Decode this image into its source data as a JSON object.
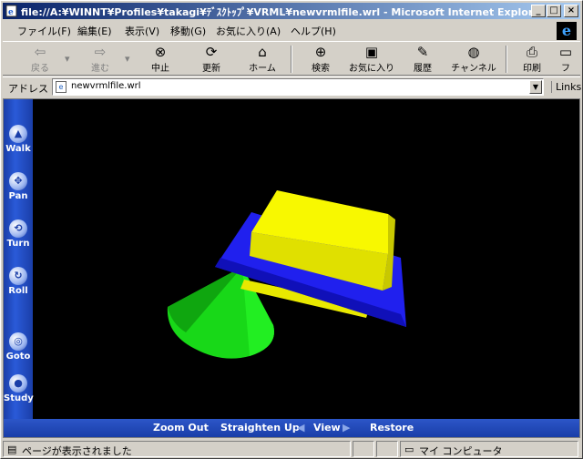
{
  "window": {
    "title": "file://A:¥WINNT¥Profiles¥takagi¥ﾃﾞｽｸﾄｯﾌﾟ¥VRML¥newvrmlfile.wrl - Microsoft Internet Explorer",
    "controls": {
      "minimize": "_",
      "maximize": "□",
      "close": "×"
    }
  },
  "menu": [
    "ファイル(F)",
    "編集(E)",
    "表示(V)",
    "移動(G)",
    "お気に入り(A)",
    "ヘルプ(H)"
  ],
  "toolbar": {
    "back": "戻る",
    "forward": "進む",
    "stop": "中止",
    "refresh": "更新",
    "home": "ホーム",
    "search": "検索",
    "favorites": "お気に入り",
    "history": "履歴",
    "channels": "チャンネル",
    "print": "印刷",
    "fullscreen": "フ"
  },
  "address": {
    "label": "アドレス",
    "value": "newvrmlfile.wrl",
    "links": "Links"
  },
  "vrml_nav": [
    "Walk",
    "Pan",
    "Turn",
    "Roll",
    "Goto",
    "Study"
  ],
  "vrml_controls": {
    "zoom_out": "Zoom Out",
    "straighten_up": "Straighten Up",
    "view": "View",
    "restore": "Restore"
  },
  "status": {
    "text": "ページが表示されました",
    "zone": "マイ コンピュータ"
  },
  "colors": {
    "scene_bg": "#000000",
    "box_yellow": "#f0f000",
    "plate_blue": "#1a1ae8",
    "cone_green": "#18e018",
    "nav_blue": "#1a3ea8"
  }
}
